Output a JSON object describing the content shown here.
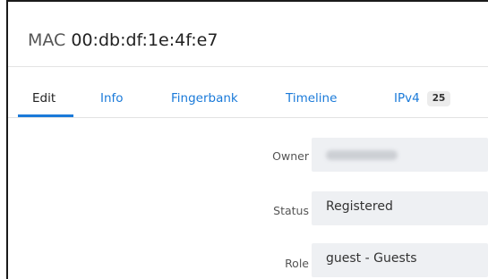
{
  "header": {
    "title_prefix": "MAC",
    "mac_address": "00:db:df:1e:4f:e7"
  },
  "tabs": [
    {
      "label": "Edit",
      "active": true
    },
    {
      "label": "Info"
    },
    {
      "label": "Fingerbank"
    },
    {
      "label": "Timeline"
    },
    {
      "label": "IPv4",
      "badge": "25"
    }
  ],
  "form": {
    "owner": {
      "label": "Owner",
      "value_redacted": true
    },
    "status": {
      "label": "Status",
      "value": "Registered"
    },
    "role": {
      "label": "Role",
      "value": "guest - Guests"
    }
  },
  "colors": {
    "link": "#1a7ad9",
    "field_bg": "#eef0f3",
    "badge_bg": "#ececec"
  }
}
